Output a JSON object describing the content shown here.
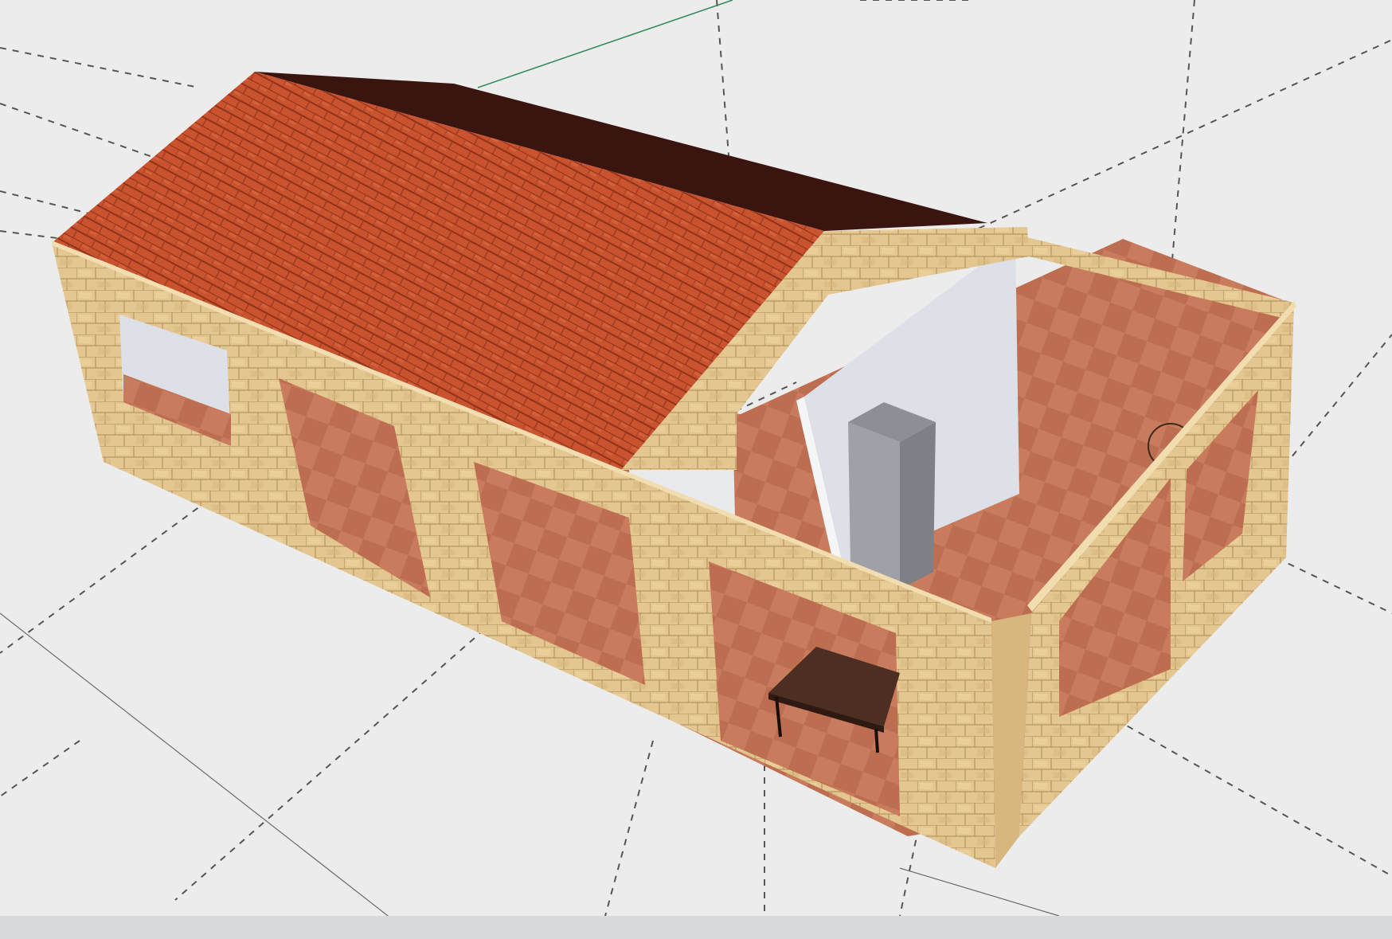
{
  "scene": {
    "type": "3d-model-viewport",
    "background_color": "#ececec",
    "guide_color": "#555555",
    "axis_color": "#2e8b57",
    "model": {
      "roof": {
        "material": "terracotta-tiles",
        "color": "#c8502e",
        "shadow_color": "#3a1510"
      },
      "walls": {
        "material": "sandstone",
        "color": "#e2c48e"
      },
      "floor": {
        "material": "terracotta-floor-tiles",
        "color": "#c47a5c"
      },
      "partitions": {
        "color": "#dde0e6"
      },
      "furniture": [
        "refrigerator",
        "table"
      ]
    }
  }
}
